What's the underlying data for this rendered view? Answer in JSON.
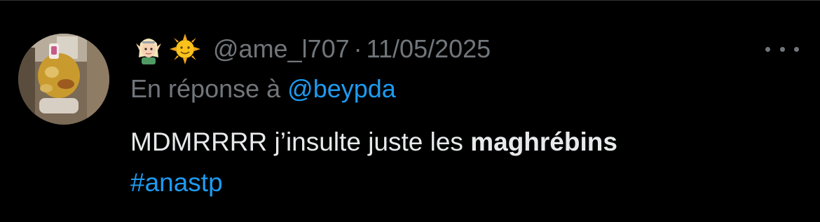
{
  "tweet": {
    "author": {
      "avatar_icon": "profile-photo-icon",
      "display_name_emojis": [
        "elf-emoji-icon",
        "sun-with-face-emoji-icon"
      ],
      "handle": "@ame_l707",
      "separator": "·",
      "date": "11/05/2025"
    },
    "more_icon": "more-options-icon",
    "reply_to": {
      "prefix": "En réponse à",
      "mention": "@beypda"
    },
    "body": {
      "text_plain": "MDMRRRR j’insulte juste les",
      "text_bold": "maghrébins",
      "hashtag": "#anastp"
    }
  },
  "colors": {
    "background": "#000000",
    "primary_text": "#e7e9ea",
    "secondary_text": "#71767b",
    "link": "#1d9bf0",
    "divider": "#2f3336"
  }
}
